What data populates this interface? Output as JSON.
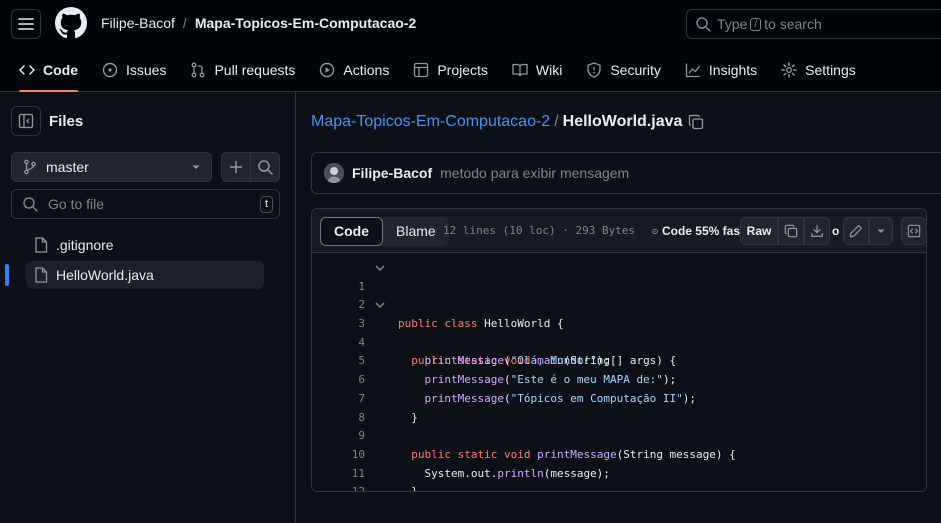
{
  "header": {
    "owner": "Filipe-Bacof",
    "separator": "/",
    "repo": "Mapa-Topicos-Em-Computacao-2",
    "search_prefix": "Type",
    "search_key": "/",
    "search_suffix": "to search"
  },
  "tabs": [
    {
      "label": "Code",
      "icon": "code-icon"
    },
    {
      "label": "Issues",
      "icon": "issue-icon"
    },
    {
      "label": "Pull requests",
      "icon": "pull-request-icon"
    },
    {
      "label": "Actions",
      "icon": "play-icon"
    },
    {
      "label": "Projects",
      "icon": "table-icon"
    },
    {
      "label": "Wiki",
      "icon": "book-icon"
    },
    {
      "label": "Security",
      "icon": "shield-icon"
    },
    {
      "label": "Insights",
      "icon": "graph-icon"
    },
    {
      "label": "Settings",
      "icon": "gear-icon"
    }
  ],
  "sidebar": {
    "title": "Files",
    "branch": "master",
    "goto_placeholder": "Go to file",
    "goto_key": "t",
    "files": [
      {
        "name": ".gitignore",
        "selected": false
      },
      {
        "name": "HelloWorld.java",
        "selected": true
      }
    ]
  },
  "main": {
    "path_repo": "Mapa-Topicos-Em-Computacao-2",
    "path_sep": "/",
    "path_file": "HelloWorld.java",
    "commit": {
      "author": "Filipe-Bacof",
      "message": "metodo para exibir mensagem"
    },
    "code_header": {
      "code_tab": "Code",
      "blame_tab": "Blame",
      "meta": "12 lines (10 loc) · 293 Bytes",
      "language_stat": "Code 55% fas",
      "raw_label": "Raw",
      "overflow_text": "o"
    }
  },
  "code_lines": [
    {
      "n": "1",
      "fold": true,
      "text": "public class HelloWorld {"
    },
    {
      "n": "2",
      "fold": false,
      "text": ""
    },
    {
      "n": "3",
      "fold": true,
      "text": "  public static void main(String[] args) {"
    },
    {
      "n": "4",
      "fold": false,
      "text": "    printMessage(\"Olá, Mundo!\");"
    },
    {
      "n": "5",
      "fold": false,
      "text": "    printMessage(\"Este é o meu MAPA de:\");"
    },
    {
      "n": "6",
      "fold": false,
      "text": "    printMessage(\"Tópicos em Computação II\");"
    },
    {
      "n": "7",
      "fold": false,
      "text": "  }"
    },
    {
      "n": "8",
      "fold": false,
      "text": ""
    },
    {
      "n": "9",
      "fold": false,
      "text": "  public static void printMessage(String message) {"
    },
    {
      "n": "10",
      "fold": false,
      "text": "    System.out.println(message);"
    },
    {
      "n": "11",
      "fold": false,
      "text": "  }"
    },
    {
      "n": "12",
      "fold": false,
      "text": "}"
    }
  ],
  "colors": {
    "background": "#0d1117",
    "header_bg": "#010409",
    "link": "#4493f8",
    "accent_underline": "#f78166",
    "keyword": "#ff7b72",
    "function": "#d2a8ff",
    "string": "#a5d6ff"
  }
}
